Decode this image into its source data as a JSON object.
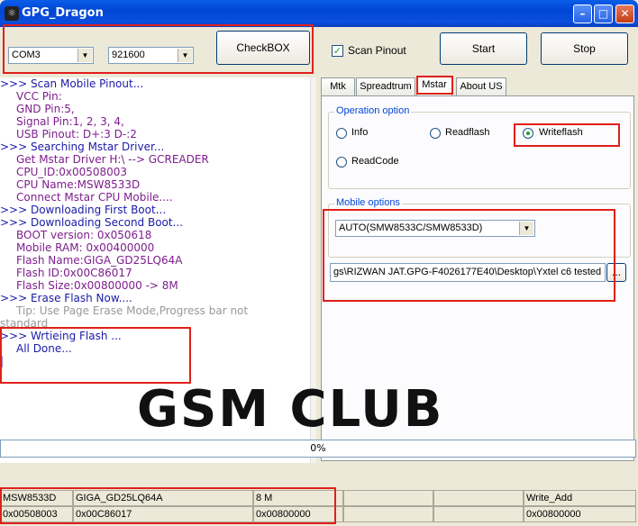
{
  "window": {
    "title": "GPG_Dragon",
    "icon": "dragon-app-icon"
  },
  "controls": {
    "com_port": "COM3",
    "baud_rate": "921600",
    "checkbox_button": "CheckBOX",
    "scan_pinout_label": "Scan Pinout",
    "scan_pinout_checked": true,
    "start_button": "Start",
    "stop_button": "Stop"
  },
  "log": [
    {
      "style": "head",
      "text": ">>> Scan Mobile Pinout..."
    },
    {
      "style": "purple",
      "text": "VCC Pin:"
    },
    {
      "style": "purple",
      "text": "GND Pin:5,"
    },
    {
      "style": "purple",
      "text": "Signal Pin:1, 2, 3, 4,"
    },
    {
      "style": "purple",
      "text": "USB Pinout: D+:3  D-:2"
    },
    {
      "style": "head",
      "text": ">>> Searching Mstar Driver..."
    },
    {
      "style": "purple",
      "text": "Get Mstar Driver  H:\\  -->  GCREADER"
    },
    {
      "style": "purple",
      "text": "CPU_ID:0x00508003"
    },
    {
      "style": "purple",
      "text": "CPU Name:MSW8533D"
    },
    {
      "style": "purple",
      "text": "Connect Mstar CPU Mobile...."
    },
    {
      "style": "head",
      "text": ">>> Downloading First Boot..."
    },
    {
      "style": "head",
      "text": ">>> Downloading Second Boot..."
    },
    {
      "style": "purple",
      "text": "BOOT version: 0x050618"
    },
    {
      "style": "purple",
      "text": "Mobile RAM: 0x00400000"
    },
    {
      "style": "purple",
      "text": "Flash Name:GIGA_GD25LQ64A"
    },
    {
      "style": "purple",
      "text": "Flash ID:0x00C86017"
    },
    {
      "style": "purple",
      "text": "Flash Size:0x00800000 -> 8M"
    },
    {
      "style": "head",
      "text": ">>> Erase Flash Now...."
    },
    {
      "style": "gray",
      "text": "Tip: Use Page Erase Mode,Progress bar not"
    },
    {
      "style": "gray2",
      "text": "standard"
    },
    {
      "style": "head",
      "text": ">>> Wrtieing Flash ..."
    },
    {
      "style": "head-indent",
      "text": "All Done..."
    },
    {
      "style": "head",
      "text": "|"
    }
  ],
  "tabs": [
    {
      "label": "Mtk",
      "active": false
    },
    {
      "label": "Spreadtrum",
      "active": false
    },
    {
      "label": "Mstar",
      "active": true
    },
    {
      "label": "About US",
      "active": false
    }
  ],
  "operation": {
    "legend": "Operation option",
    "options": [
      {
        "label": "Info",
        "selected": false
      },
      {
        "label": "Readflash",
        "selected": false
      },
      {
        "label": "Writeflash",
        "selected": true
      },
      {
        "label": "ReadCode",
        "selected": false
      }
    ]
  },
  "mobile": {
    "legend": "Mobile options",
    "model": "AUTO(SMW8533C/SMW8533D)",
    "path": "gs\\RIZWAN JAT.GPG-F4026177E40\\Desktop\\Yxtel c6 tested",
    "browse_button": "..."
  },
  "progress": {
    "text": "0%",
    "value": 0
  },
  "status_rows": [
    [
      "MSW8533D",
      "GIGA_GD25LQ64A",
      "8 M",
      "",
      "",
      "Write_Add"
    ],
    [
      "0x00508003",
      "0x00C86017",
      "0x00800000",
      "",
      "",
      "0x00800000"
    ]
  ],
  "watermark": "GSM CLUB",
  "highlight_color": "#e0201a"
}
